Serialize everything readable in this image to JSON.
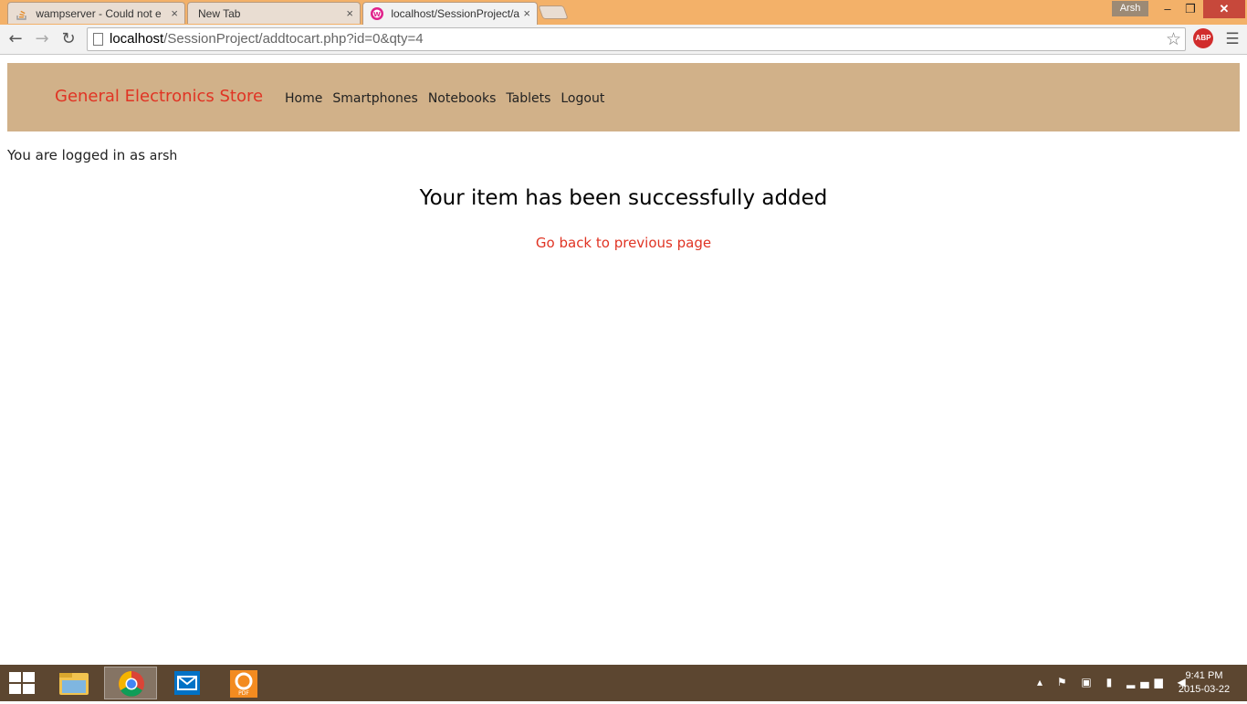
{
  "browser": {
    "tabs": [
      {
        "title": "wampserver - Could not e",
        "icon": "stackoverflow-icon"
      },
      {
        "title": "New Tab",
        "icon": "none"
      },
      {
        "title": "localhost/SessionProject/a",
        "icon": "wampserver-icon"
      }
    ],
    "profile_name": "Arsh",
    "window_controls": {
      "minimize": "–",
      "restore": "❐",
      "close": "✕"
    },
    "url_host": "localhost",
    "url_path": "/SessionProject/addtocart.php?id=0&qty=4",
    "extension_badge": "ABP"
  },
  "page": {
    "brand": "General Electronics Store",
    "nav": [
      "Home",
      "Smartphones",
      "Notebooks",
      "Tablets",
      "Logout"
    ],
    "login_prefix": "You are logged in as",
    "username": "arsh",
    "success_message": "Your item has been successfully added",
    "back_link": "Go back to previous page"
  },
  "taskbar": {
    "apps": [
      "file-explorer-icon",
      "chrome-icon",
      "mail-icon",
      "pdf-icon"
    ],
    "time": "9:41 PM",
    "date": "2015-03-22"
  },
  "colors": {
    "tabstrip": "#f3b169",
    "navbar": "#d1b189",
    "brand": "#e03424",
    "link": "#e03424",
    "taskbar": "#5c4630"
  }
}
